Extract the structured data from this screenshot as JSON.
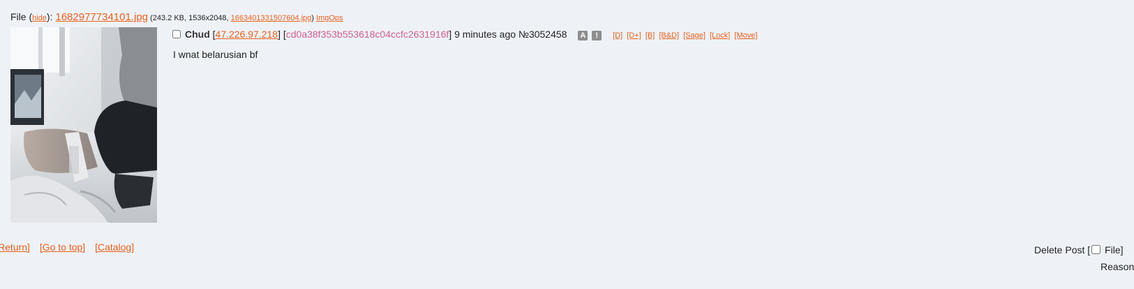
{
  "file": {
    "prefix": "File (",
    "hide_label": "hide",
    "after_hide": "): ",
    "filename": "1682977734101.jpg",
    "meta_open": " (243.2 KB, 1536x2048, ",
    "original_name": "1663401331507604.jpg",
    "meta_close": ") ",
    "imgops_label": "ImgOps"
  },
  "post": {
    "name": "Chud",
    "ip_open": " [",
    "ip": "47.226.97.218",
    "ip_close": "]",
    "hash_open": " [",
    "hash": "cd0a38f353b553618c04ccfc2631916f",
    "hash_close": "]",
    "time": " 9 minutes ago ",
    "number": "№3052458",
    "badge_a": "A",
    "badge_warn": "!",
    "mod_links": [
      "[D]",
      "[D+]",
      "[B]",
      "[B&D]",
      "[Sage]",
      "[Lock]",
      "[Move]"
    ],
    "comment": "I wnat belarusian bf"
  },
  "nav": {
    "return_label": "Return]",
    "top_label": "[Go to top]",
    "catalog_label": "[Catalog]"
  },
  "delete": {
    "label_start": "Delete Post [",
    "label_end": " File]",
    "reason_label": "Reason"
  },
  "colors": {
    "background": "#eef2f7",
    "link": "#e8601c",
    "hash": "#d05f92"
  }
}
